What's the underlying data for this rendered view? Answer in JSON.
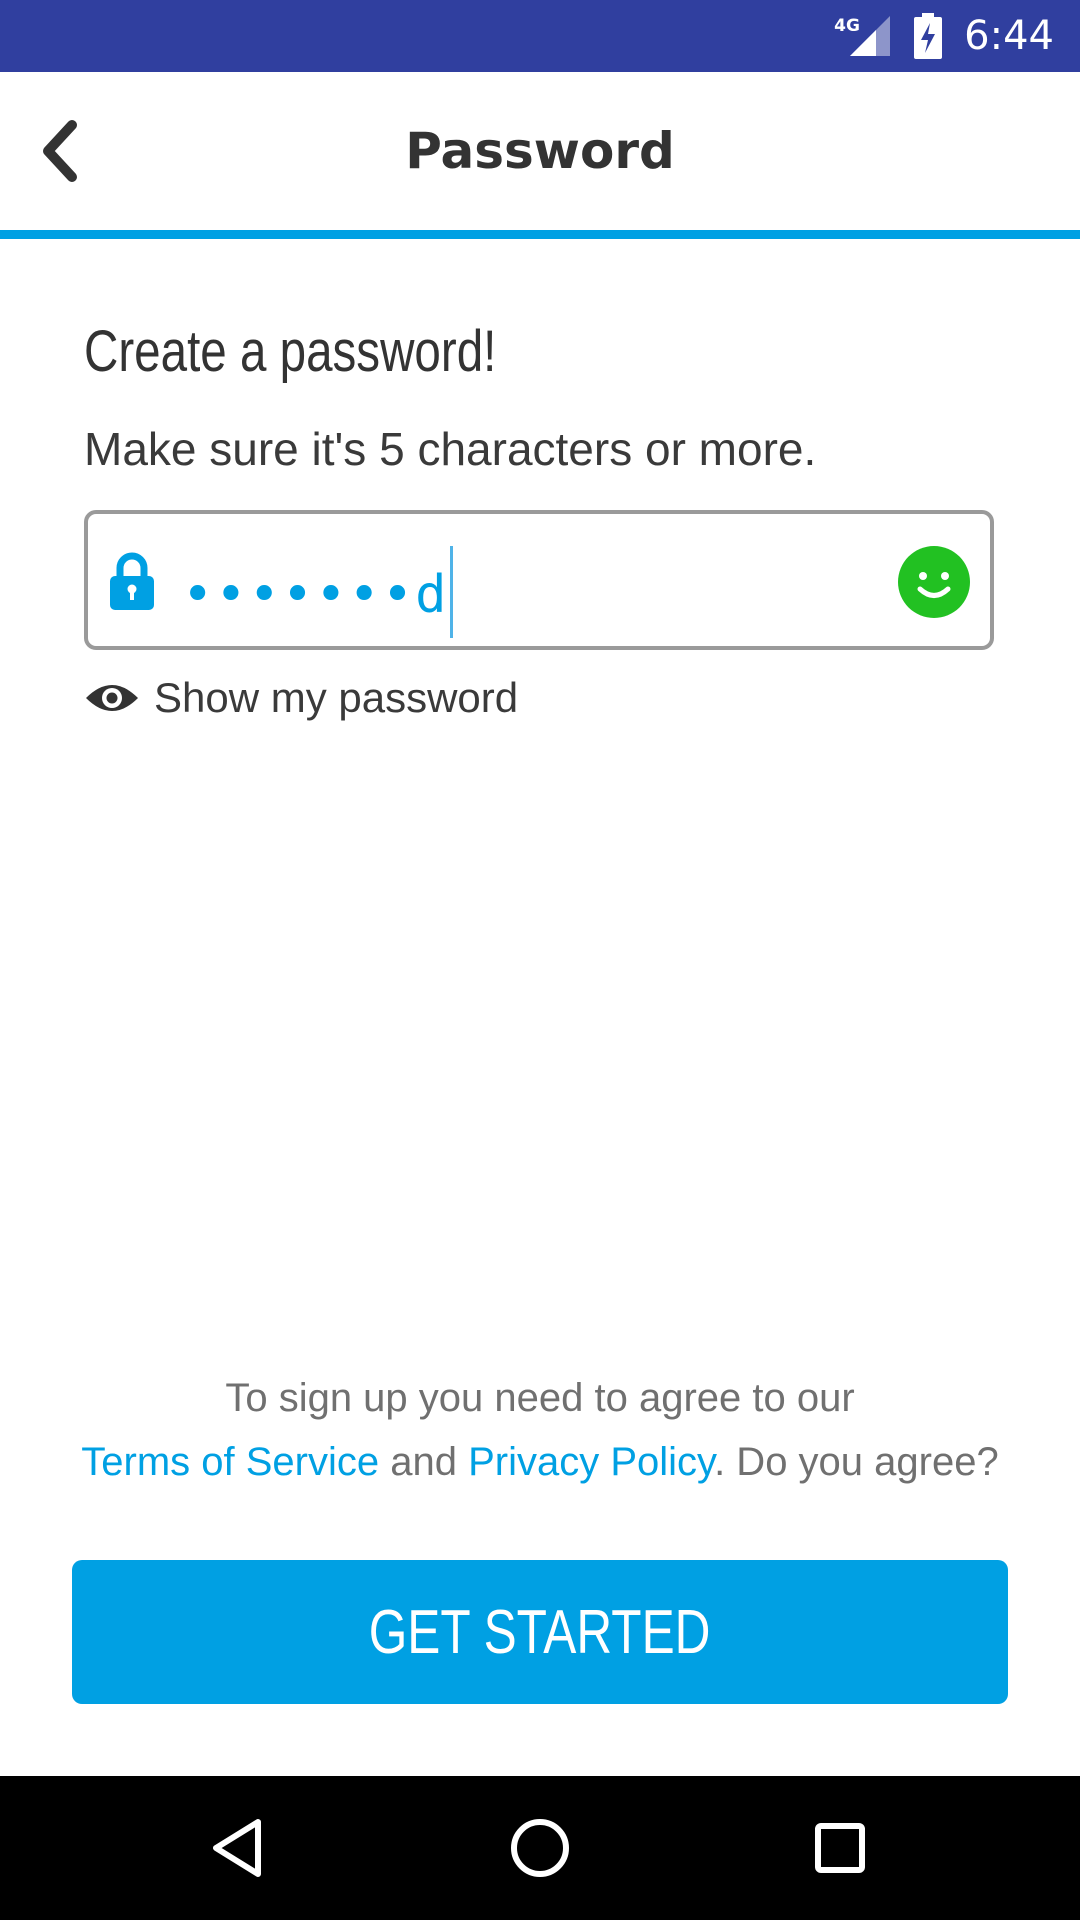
{
  "status_bar": {
    "network": "4G",
    "time": "6:44",
    "icons": [
      "signal-icon",
      "battery-charging-icon"
    ],
    "background_color": "#303F9F"
  },
  "app_bar": {
    "title": "Password",
    "back_icon": "chevron-left-icon",
    "progress_color": "#00A0E3"
  },
  "content": {
    "heading": "Create a password!",
    "subheading": "Make sure it's 5 characters or more.",
    "password_field": {
      "value": "•••••••d",
      "lock_icon": "lock-icon",
      "status_icon": "smiley-icon",
      "status_color": "#22C122"
    },
    "show_password": {
      "label": "Show my password",
      "icon": "eye-icon"
    }
  },
  "terms": {
    "line1": "To sign up you need to agree to our",
    "tos_link": "Terms of Service",
    "and": " and ",
    "privacy_link": "Privacy Policy",
    "question": ". Do you agree?"
  },
  "cta": {
    "label": "GET STARTED",
    "color": "#00A0E3"
  },
  "nav_bar": {
    "buttons": [
      "back-triangle-icon",
      "home-circle-icon",
      "recents-square-icon"
    ]
  }
}
